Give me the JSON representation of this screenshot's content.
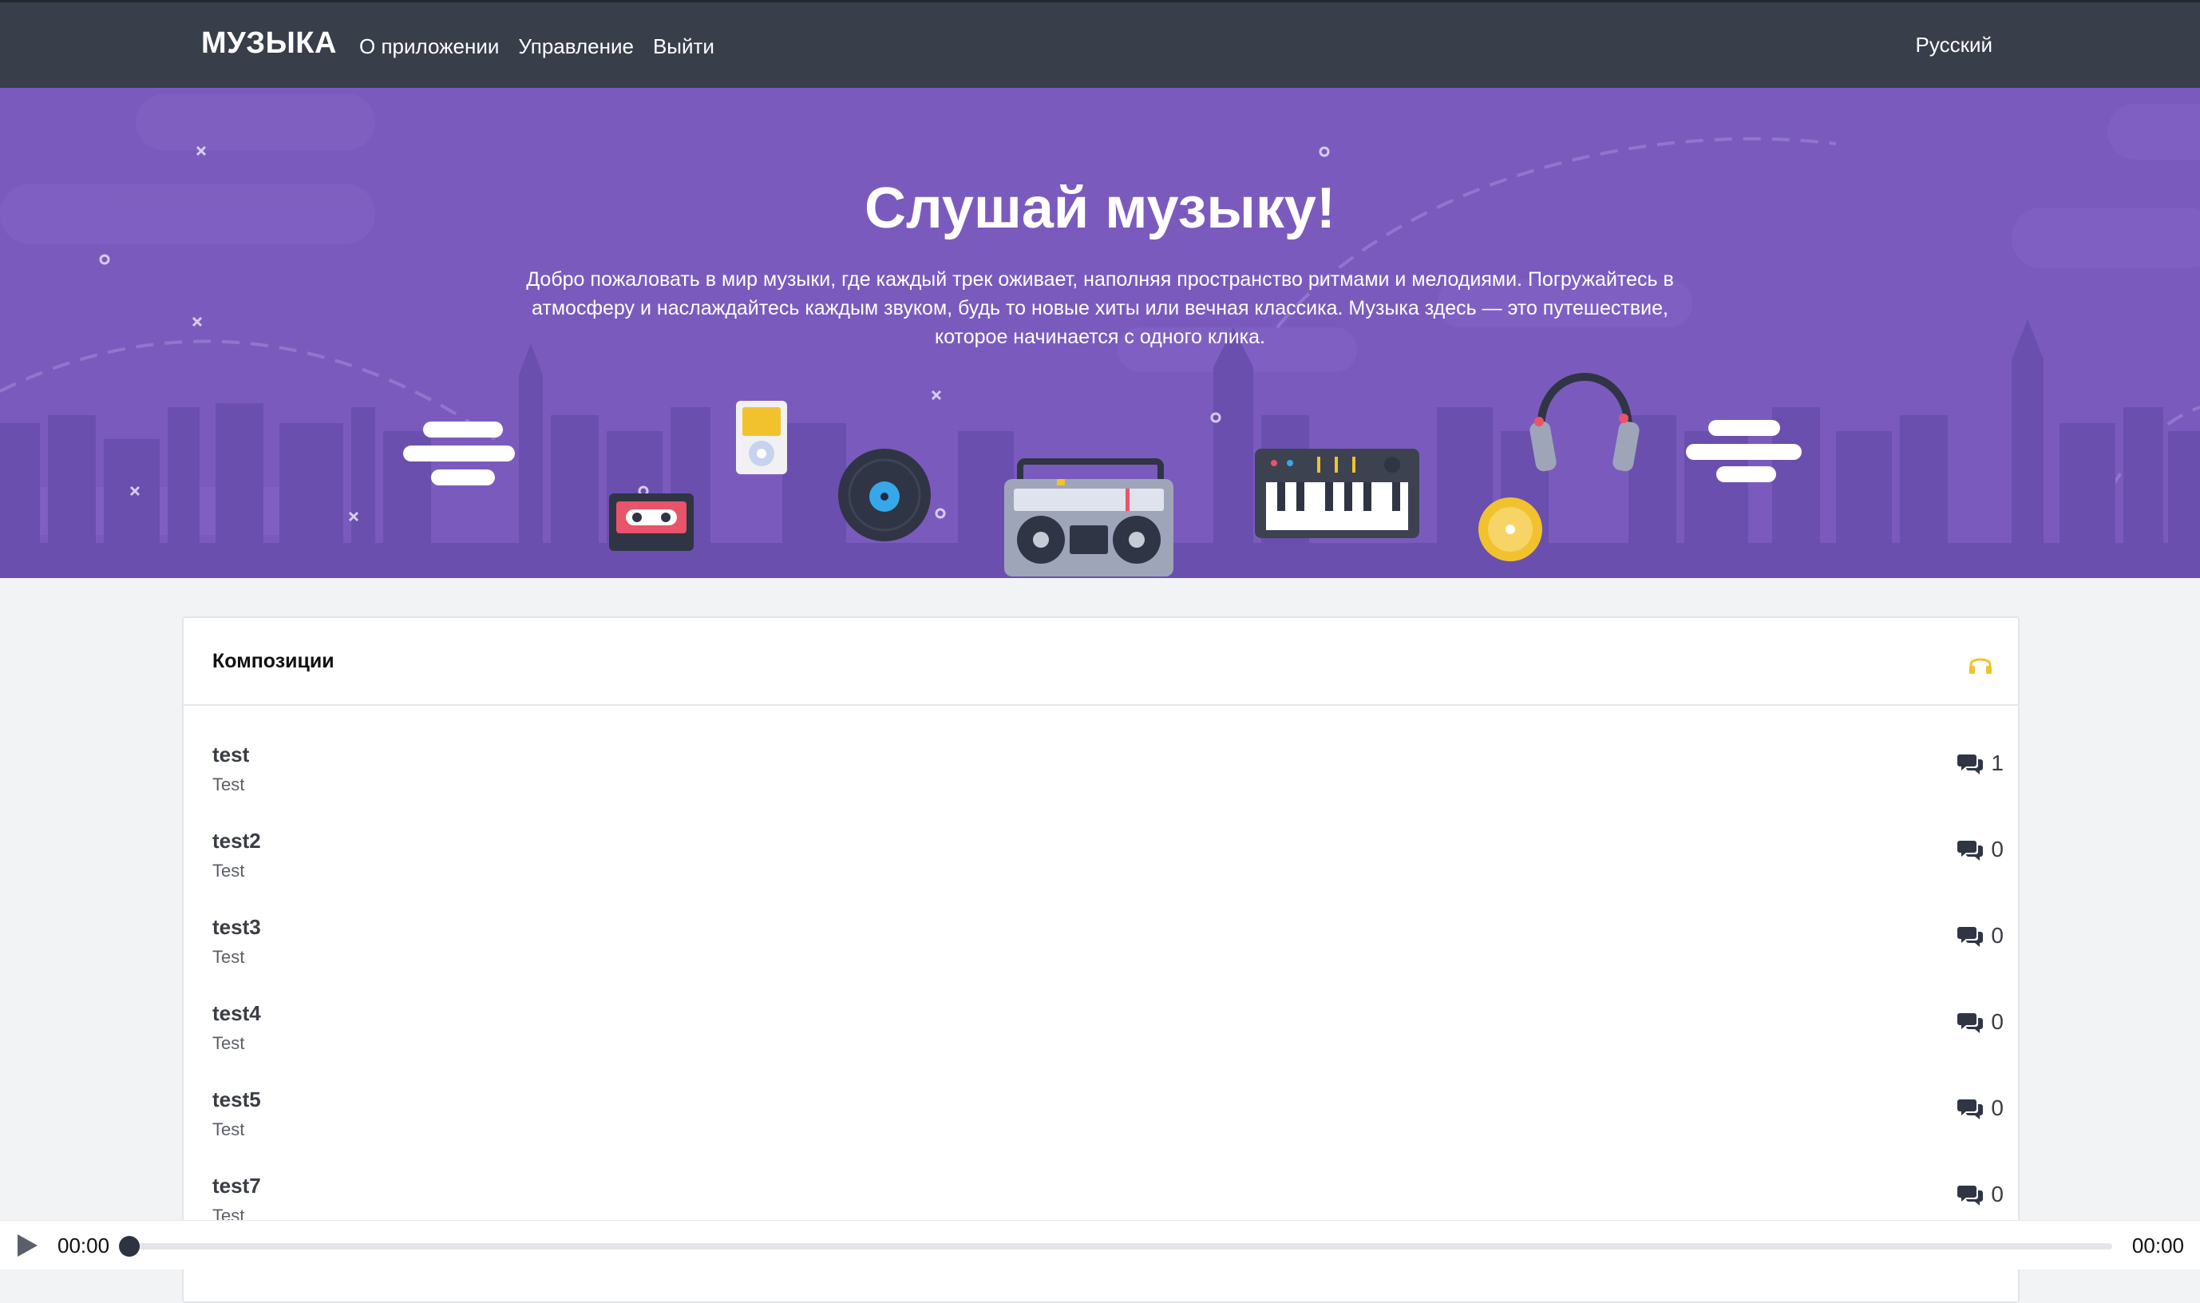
{
  "nav": {
    "brand": "МУЗЫКА",
    "links": [
      "О приложении",
      "Управление",
      "Выйти"
    ],
    "language": "Русский"
  },
  "hero": {
    "title": "Слушай музыку!",
    "text": "Добро пожаловать в мир музыки, где каждый трек оживает, наполняя пространство ритмами и мелодиями. Погружайтесь в атмосферу и наслаждайтесь каждым звуком, будь то новые хиты или вечная классика. Музыка здесь — это путешествие, которое начинается с одного клика."
  },
  "card": {
    "title": "Композиции",
    "icon": "headphones-icon"
  },
  "tracks": [
    {
      "name": "test",
      "artist": "Test",
      "comments": "1"
    },
    {
      "name": "test2",
      "artist": "Test",
      "comments": "0"
    },
    {
      "name": "test3",
      "artist": "Test",
      "comments": "0"
    },
    {
      "name": "test4",
      "artist": "Test",
      "comments": "0"
    },
    {
      "name": "test5",
      "artist": "Test",
      "comments": "0"
    },
    {
      "name": "test7",
      "artist": "Test",
      "comments": "0"
    }
  ],
  "player": {
    "current_time": "00:00",
    "total_time": "00:00",
    "progress": 0
  },
  "colors": {
    "navbar": "#383e4a",
    "hero": "#7a5bbd",
    "accent_yellow": "#f2c12e"
  }
}
